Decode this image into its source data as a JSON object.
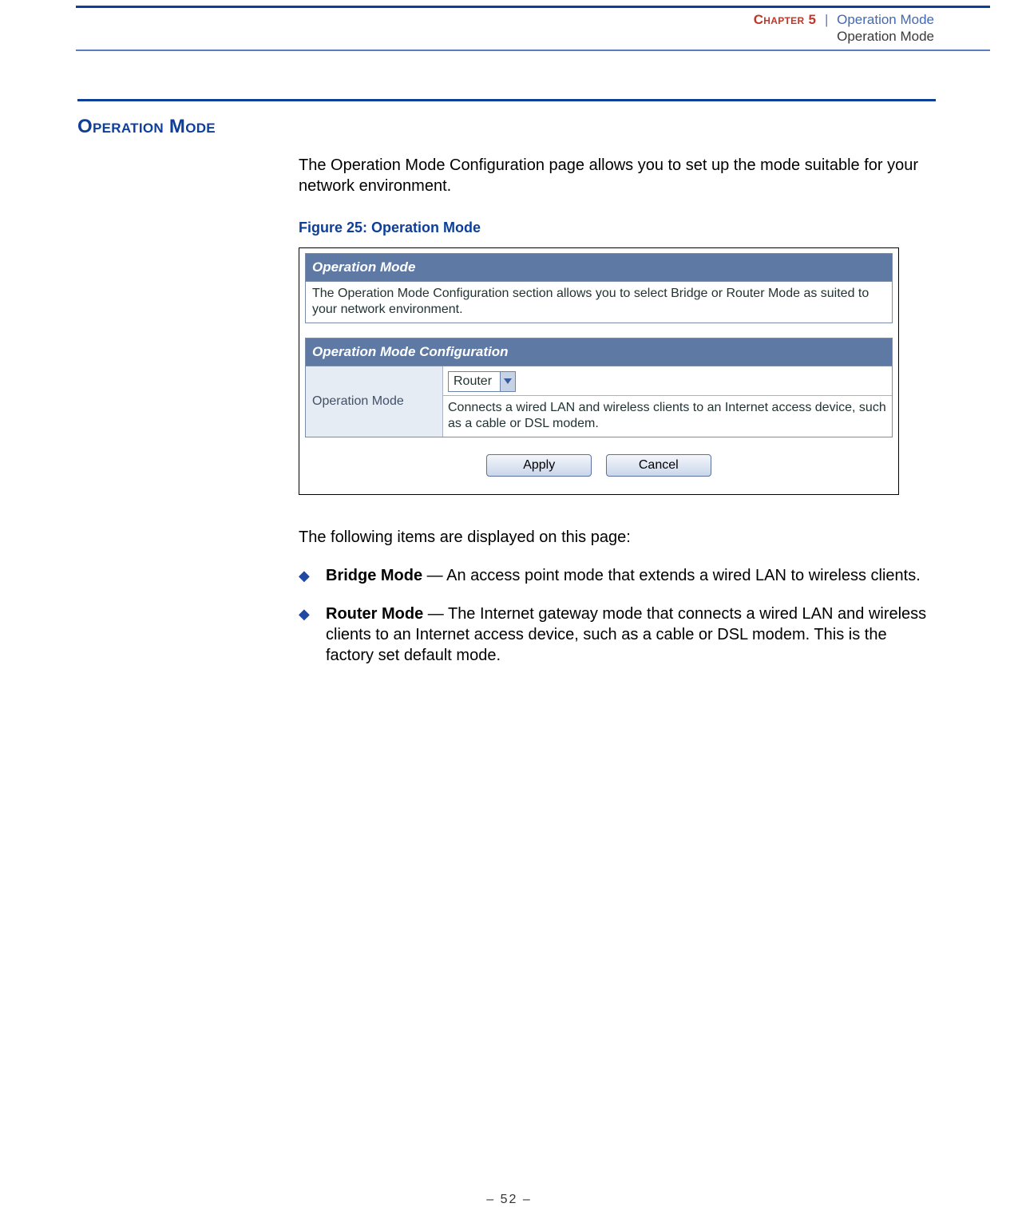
{
  "header": {
    "chapter_label": "Chapter 5",
    "separator": "|",
    "chapter_title": "Operation Mode",
    "sub": "Operation Mode"
  },
  "section_title": "Operation Mode",
  "intro": "The Operation Mode Configuration page allows you to set up the mode suitable for your network environment.",
  "figure_caption": "Figure 25:  Operation Mode",
  "screenshot": {
    "panel1_head": "Operation Mode",
    "panel1_desc": "The Operation Mode Configuration section allows you to select Bridge or Router Mode as suited to your network environment.",
    "panel2_head": "Operation Mode Configuration",
    "cfg_label": "Operation Mode",
    "select_value": "Router",
    "cfg_desc": "Connects a wired LAN and wireless clients to an Internet access device, such as a cable or DSL modem.",
    "apply": "Apply",
    "cancel": "Cancel"
  },
  "post_intro": "The following items are displayed on this page:",
  "items": [
    {
      "term": "Bridge Mode",
      "desc": " — An access point mode that extends a wired LAN to wireless clients."
    },
    {
      "term": "Router Mode",
      "desc": " — The Internet gateway mode that connects a wired LAN and wireless clients to an Internet access device, such as a cable or DSL modem. This is the factory set default mode."
    }
  ],
  "page_number": "–  52  –"
}
